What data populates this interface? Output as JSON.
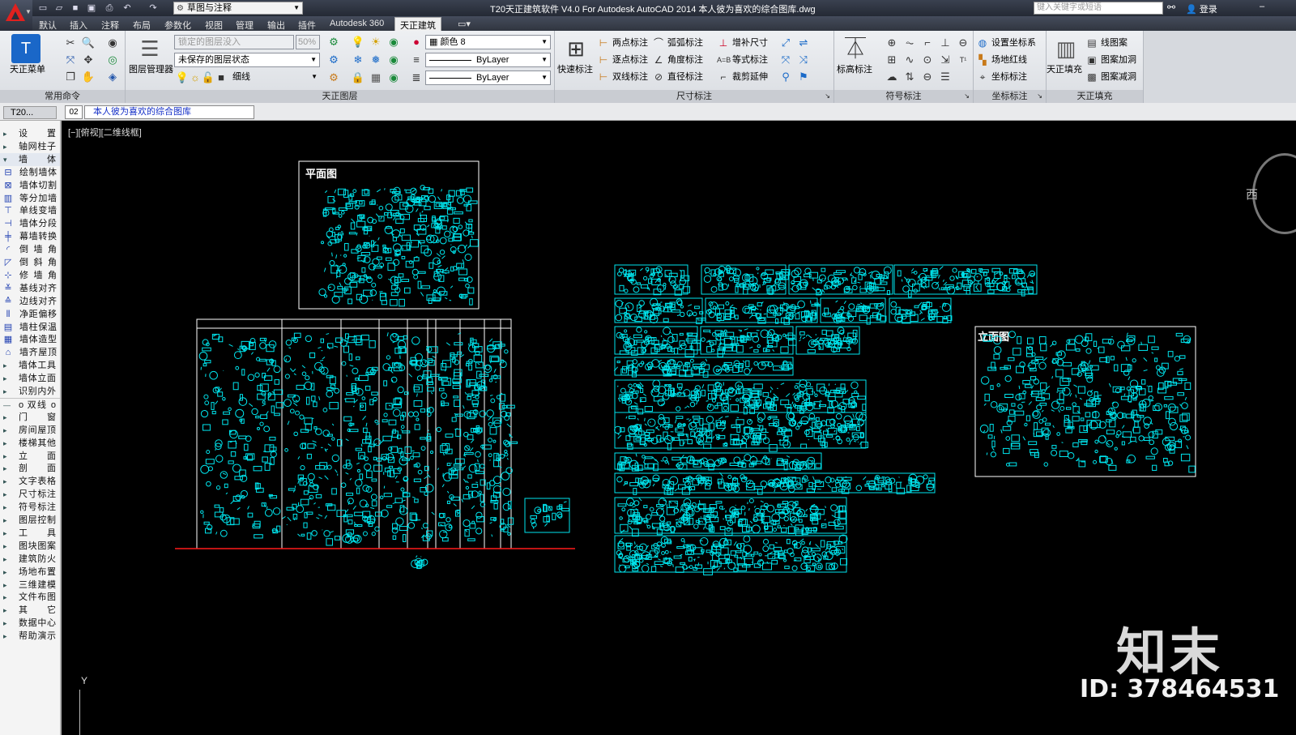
{
  "titlebar": {
    "workspace": "草图与注释",
    "title": "T20天正建筑软件 V4.0 For Autodesk AutoCAD 2014    本人彼为喜欢的综合图库.dwg",
    "search_placeholder": "键入关键字或短语",
    "login": "登录"
  },
  "tabs": [
    "默认",
    "插入",
    "注释",
    "布局",
    "参数化",
    "视图",
    "管理",
    "输出",
    "插件",
    "Autodesk 360",
    "天正建筑"
  ],
  "active_tab": "天正建筑",
  "ribbon": {
    "common": {
      "title": "常用命令",
      "menu_label": "天正菜单"
    },
    "layers": {
      "title": "天正图层",
      "manager_label": "图层管理器",
      "lock_placeholder": "锁定的图层没入",
      "percent": "50%",
      "layer_state": "未保存的图层状态",
      "layer_name": "细线",
      "color": "颜色 8",
      "linetype": "ByLayer",
      "lineweight": "ByLayer"
    },
    "dimension": {
      "title": "尺寸标注",
      "quick_label": "快速标注",
      "items": [
        "两点标注",
        "逐点标注",
        "双线标注",
        "弧弧标注",
        "角度标注",
        "直径标注",
        "增补尺寸",
        "等式标注",
        "裁剪延伸"
      ]
    },
    "symbol": {
      "title": "符号标注",
      "elev_label": "标高标注"
    },
    "coord": {
      "title": "坐标标注",
      "items": [
        "设置坐标系",
        "场地红线",
        "坐标标注"
      ]
    },
    "fill": {
      "title": "天正填充",
      "fill_label": "天正填充",
      "items": [
        "线图案",
        "图案加洞",
        "图案减洞"
      ]
    }
  },
  "docbar": {
    "palette_tab": "T20...",
    "doc_number": "02",
    "doc_title": "本人彼为喜欢的综合图库"
  },
  "left_palette": [
    {
      "label": "设　置",
      "kind": "collapsed"
    },
    {
      "label": "轴网柱子",
      "kind": "collapsed"
    },
    {
      "label": "墙　体",
      "kind": "open"
    },
    {
      "label": "绘制墙体",
      "kind": "sub",
      "icon": "wall-draw-icon"
    },
    {
      "label": "墙体切割",
      "kind": "sub",
      "icon": "wall-cut-icon"
    },
    {
      "label": "等分加墙",
      "kind": "sub",
      "icon": "wall-divide-icon"
    },
    {
      "label": "单线变墙",
      "kind": "sub",
      "icon": "line-to-wall-icon"
    },
    {
      "label": "墙体分段",
      "kind": "sub",
      "icon": "wall-split-icon"
    },
    {
      "label": "幕墙转换",
      "kind": "sub",
      "icon": "curtain-wall-icon"
    },
    {
      "label": "倒 墙 角",
      "kind": "sub",
      "icon": "fillet-wall-icon"
    },
    {
      "label": "倒 斜 角",
      "kind": "sub",
      "icon": "chamfer-wall-icon"
    },
    {
      "label": "修 墙 角",
      "kind": "sub",
      "icon": "fix-corner-icon"
    },
    {
      "label": "基线对齐",
      "kind": "sub",
      "icon": "baseline-align-icon"
    },
    {
      "label": "边线对齐",
      "kind": "sub",
      "icon": "edge-align-icon"
    },
    {
      "label": "净距偏移",
      "kind": "sub",
      "icon": "offset-icon"
    },
    {
      "label": "墙柱保温",
      "kind": "sub",
      "icon": "insulation-icon"
    },
    {
      "label": "墙体造型",
      "kind": "sub",
      "icon": "wall-shape-icon"
    },
    {
      "label": "墙齐屋顶",
      "kind": "sub",
      "icon": "wall-roof-icon"
    },
    {
      "label": "墙体工具",
      "kind": "collapsed"
    },
    {
      "label": "墙体立面",
      "kind": "collapsed"
    },
    {
      "label": "识别内外",
      "kind": "collapsed"
    },
    {
      "label": "o 双线 o",
      "kind": "header"
    },
    {
      "label": "门　窗",
      "kind": "collapsed"
    },
    {
      "label": "房间屋顶",
      "kind": "collapsed"
    },
    {
      "label": "楼梯其他",
      "kind": "collapsed"
    },
    {
      "label": "立　面",
      "kind": "collapsed"
    },
    {
      "label": "剖　面",
      "kind": "collapsed"
    },
    {
      "label": "文字表格",
      "kind": "collapsed"
    },
    {
      "label": "尺寸标注",
      "kind": "collapsed"
    },
    {
      "label": "符号标注",
      "kind": "collapsed"
    },
    {
      "label": "图层控制",
      "kind": "collapsed"
    },
    {
      "label": "工　具",
      "kind": "collapsed"
    },
    {
      "label": "图块图案",
      "kind": "collapsed"
    },
    {
      "label": "建筑防火",
      "kind": "collapsed"
    },
    {
      "label": "场地布置",
      "kind": "collapsed"
    },
    {
      "label": "三维建模",
      "kind": "collapsed"
    },
    {
      "label": "文件布图",
      "kind": "collapsed"
    },
    {
      "label": "其　它",
      "kind": "collapsed"
    },
    {
      "label": "数据中心",
      "kind": "collapsed"
    },
    {
      "label": "帮助演示",
      "kind": "collapsed"
    }
  ],
  "canvas": {
    "view_label": "[−][俯视][二维线框]",
    "plan_title": "平面图",
    "elevation_title": "立面图",
    "compass_label": "西",
    "ucs_y": "Y",
    "watermark_logo": "知末",
    "watermark_id": "ID: 378464531",
    "colors": {
      "cyan": "#00e5ee",
      "white": "#ffffff",
      "red": "#ff1a1a",
      "background": "#000000"
    }
  }
}
